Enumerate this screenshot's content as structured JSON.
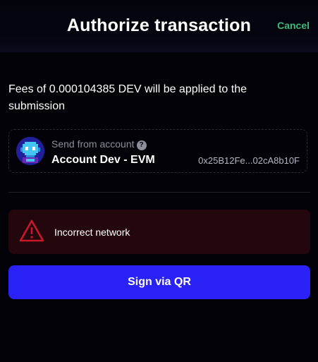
{
  "header": {
    "title": "Authorize transaction",
    "cancel_label": "Cancel"
  },
  "fees": {
    "text": "Fees of 0.000104385 DEV will be applied to the submission"
  },
  "account": {
    "label": "Send from account",
    "help_glyph": "?",
    "name": "Account Dev - EVM",
    "address": "0x25B12Fe...02cA8b10F",
    "avatar_icon": "pixel-avatar-icon"
  },
  "alert": {
    "icon": "warning-triangle-icon",
    "message": "Incorrect network"
  },
  "actions": {
    "sign_label": "Sign via QR"
  },
  "colors": {
    "background": "#020208",
    "accent": "#2a22f5",
    "cancel": "#3fb97b",
    "alert_bg": "#24070d",
    "alert_icon": "#c8182c"
  }
}
